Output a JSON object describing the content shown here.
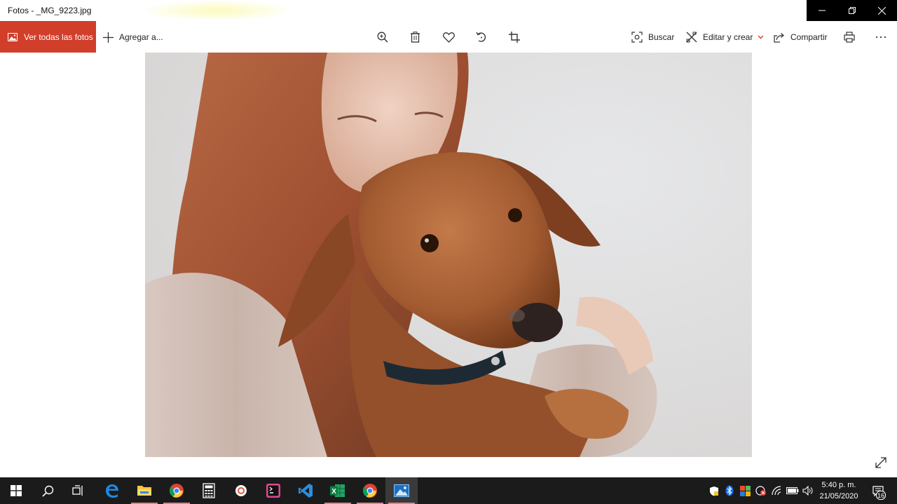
{
  "window": {
    "title": "Fotos - _MG_9223.jpg",
    "controls": [
      "minimize-icon",
      "restore-icon",
      "close-icon"
    ]
  },
  "toolbar": {
    "view_all_label": "Ver todas las fotos",
    "add_label": "Agregar a...",
    "center_icons": [
      "zoom-icon",
      "delete-icon",
      "favorite-icon",
      "rotate-icon",
      "crop-icon"
    ],
    "search_label": "Buscar",
    "edit_label": "Editar y crear",
    "share_label": "Compartir",
    "print_icon": "print-icon",
    "more_icon": "more-icon",
    "accent_color": "#d13e2a"
  },
  "viewer": {
    "image_subject": "photo",
    "expand_icon": "expand-icon"
  },
  "taskbar": {
    "apps": [
      "start-icon",
      "search-icon",
      "task-view-icon",
      "edge-icon",
      "file-explorer-icon",
      "chrome-icon",
      "calculator-icon",
      "app-icon",
      "terminal-icon",
      "vscode-icon",
      "excel-icon",
      "chrome-icon",
      "photos-icon"
    ],
    "tray_icons": [
      "security-icon",
      "bluetooth-icon",
      "office-icon",
      "network-status-icon",
      "wifi-icon",
      "battery-icon",
      "volume-icon"
    ],
    "clock_time": "5:40 p. m.",
    "clock_date": "21/05/2020",
    "notification_count": "16"
  }
}
